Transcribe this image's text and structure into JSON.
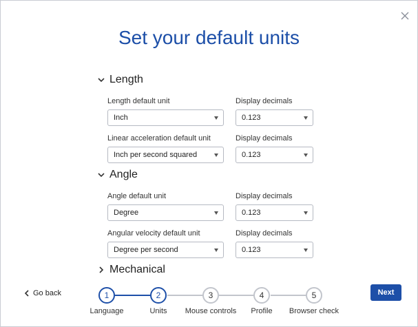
{
  "dialog": {
    "title": "Set your default units",
    "close_icon": "close-icon"
  },
  "sections": {
    "length": {
      "heading": "Length",
      "expanded": true,
      "fields": [
        {
          "label": "Length default unit",
          "value": "Inch",
          "decimals_label": "Display decimals",
          "decimals_value": "0.123"
        },
        {
          "label": "Linear acceleration default unit",
          "value": "Inch per second squared",
          "decimals_label": "Display decimals",
          "decimals_value": "0.123"
        }
      ]
    },
    "angle": {
      "heading": "Angle",
      "expanded": true,
      "fields": [
        {
          "label": "Angle default unit",
          "value": "Degree",
          "decimals_label": "Display decimals",
          "decimals_value": "0.123"
        },
        {
          "label": "Angular velocity default unit",
          "value": "Degree per second",
          "decimals_label": "Display decimals",
          "decimals_value": "0.123"
        }
      ]
    },
    "mechanical": {
      "heading": "Mechanical",
      "expanded": false
    }
  },
  "footer": {
    "go_back": "Go back",
    "next": "Next",
    "steps": [
      {
        "number": "1",
        "label": "Language",
        "state": "complete"
      },
      {
        "number": "2",
        "label": "Units",
        "state": "current"
      },
      {
        "number": "3",
        "label": "Mouse controls",
        "state": "pending"
      },
      {
        "number": "4",
        "label": "Profile",
        "state": "pending"
      },
      {
        "number": "5",
        "label": "Browser check",
        "state": "pending"
      }
    ]
  },
  "colors": {
    "accent": "#1d4fa8",
    "step_inactive": "#c2c5cc",
    "border": "#b5b9c2"
  }
}
